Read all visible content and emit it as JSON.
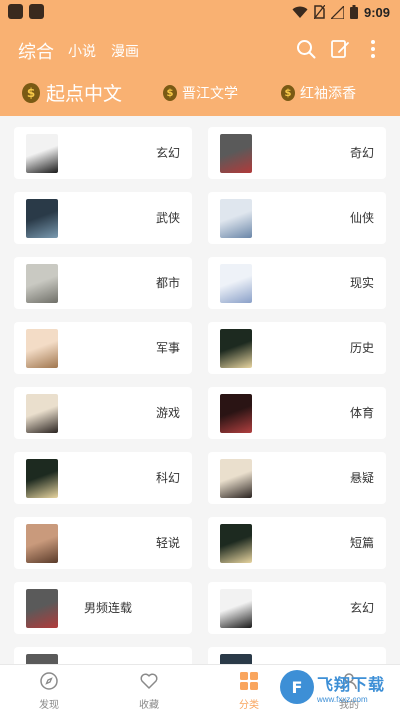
{
  "status_bar": {
    "time": "9:09",
    "icons": [
      "notification-square-icon",
      "notification-square-icon",
      "wifi-icon",
      "no-sim-icon",
      "signal-icon",
      "battery-icon"
    ]
  },
  "header": {
    "tabs": [
      {
        "label": "综合",
        "active": true
      },
      {
        "label": "小说"
      },
      {
        "label": "漫画"
      }
    ],
    "icons": [
      "search-icon",
      "edit-icon",
      "more-vertical-icon"
    ]
  },
  "sources": [
    {
      "label": "起点中文",
      "icon": "money-bag-icon"
    },
    {
      "label": "晋江文学",
      "icon": "money-bag-icon"
    },
    {
      "label": "红袖添香",
      "icon": "money-bag-icon"
    }
  ],
  "categories": [
    {
      "label": "玄幻",
      "thumb_colors": [
        "#f2f2f2",
        "#1a1a1a"
      ]
    },
    {
      "label": "奇幻",
      "thumb_colors": [
        "#5a5a5a",
        "#b23a3a"
      ]
    },
    {
      "label": "武侠",
      "thumb_colors": [
        "#2a3a48",
        "#7a9ab0"
      ]
    },
    {
      "label": "仙侠",
      "thumb_colors": [
        "#dfe6ee",
        "#6a86a8"
      ]
    },
    {
      "label": "都市",
      "thumb_colors": [
        "#c9c9c2",
        "#6f6f68"
      ]
    },
    {
      "label": "现实",
      "thumb_colors": [
        "#eef2f8",
        "#8aa0c8"
      ]
    },
    {
      "label": "军事",
      "thumb_colors": [
        "#f3dcc6",
        "#a0764e"
      ]
    },
    {
      "label": "历史",
      "thumb_colors": [
        "#1d2a20",
        "#e8d5a0"
      ]
    },
    {
      "label": "游戏",
      "thumb_colors": [
        "#eadfcd",
        "#2a2320"
      ]
    },
    {
      "label": "体育",
      "thumb_colors": [
        "#2a1414",
        "#b24040"
      ]
    },
    {
      "label": "科幻",
      "thumb_colors": [
        "#1d2a20",
        "#e8d5a0"
      ]
    },
    {
      "label": "悬疑",
      "thumb_colors": [
        "#eadfcd",
        "#2a2320"
      ]
    },
    {
      "label": "轻说",
      "thumb_colors": [
        "#c99a7c",
        "#5a3b2a"
      ]
    },
    {
      "label": "短篇",
      "thumb_colors": [
        "#1d2a20",
        "#e8d5a0"
      ]
    },
    {
      "label": "男频连载",
      "thumb_colors": [
        "#5a5a5a",
        "#b23a3a"
      ]
    },
    {
      "label": "玄幻",
      "thumb_colors": [
        "#f2f2f2",
        "#1a1a1a"
      ]
    },
    {
      "label": "",
      "thumb_colors": [
        "#5a5a5a",
        "#b23a3a"
      ]
    },
    {
      "label": "",
      "thumb_colors": [
        "#2a3a48",
        "#7a9ab0"
      ]
    }
  ],
  "bottom_nav": [
    {
      "label": "发现",
      "icon": "compass-icon"
    },
    {
      "label": "收藏",
      "icon": "heart-icon"
    },
    {
      "label": "分类",
      "icon": "grid-icon",
      "active": true
    },
    {
      "label": "我的",
      "icon": "user-icon"
    }
  ],
  "watermark": {
    "title": "飞翔下载",
    "subtitle": "www.fxxz.com"
  },
  "colors": {
    "accent": "#f9b172",
    "active_nav": "#f9a55e",
    "background": "#f5f5f5"
  }
}
